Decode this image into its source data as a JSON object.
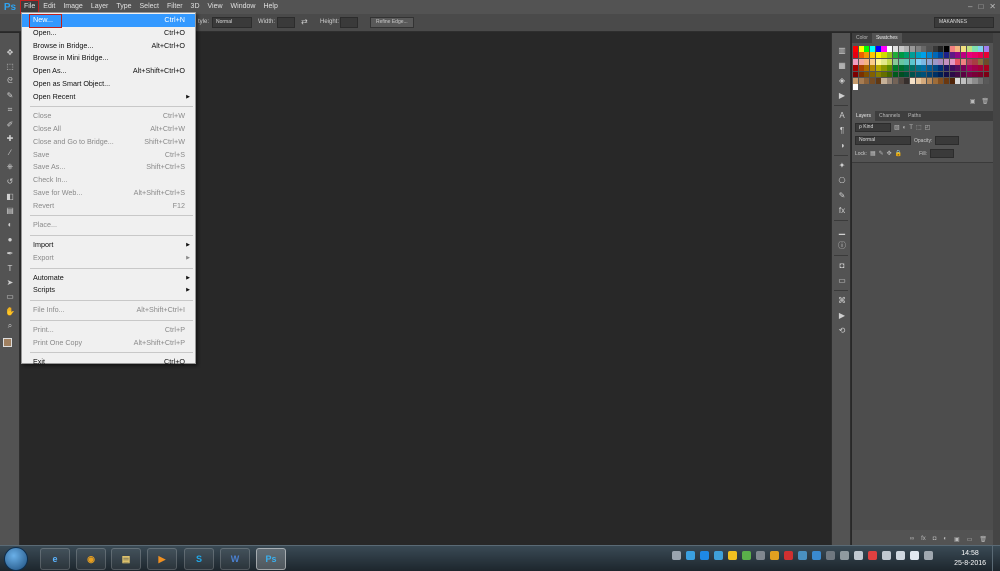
{
  "app": {
    "logo": "Ps"
  },
  "menubar": {
    "items": [
      "File",
      "Edit",
      "Image",
      "Layer",
      "Type",
      "Select",
      "Filter",
      "3D",
      "View",
      "Window",
      "Help"
    ],
    "window_buttons": [
      "–",
      "□",
      "✕"
    ]
  },
  "options_bar": {
    "style_label": "tyle:",
    "style_value": "Normal",
    "width_label": "Width:",
    "height_label": "Height:",
    "refine_edge": "Refine Edge...",
    "workspace": "MAKANNES"
  },
  "file_menu": {
    "items": [
      {
        "label": "New...",
        "shortcut": "Ctrl+N",
        "highlight": true
      },
      {
        "label": "Open...",
        "shortcut": "Ctrl+O"
      },
      {
        "label": "Browse in Bridge...",
        "shortcut": "Alt+Ctrl+O"
      },
      {
        "label": "Browse in Mini Bridge...",
        "shortcut": ""
      },
      {
        "label": "Open As...",
        "shortcut": "Alt+Shift+Ctrl+O"
      },
      {
        "label": "Open as Smart Object...",
        "shortcut": ""
      },
      {
        "label": "Open Recent",
        "shortcut": "",
        "submenu": true
      },
      {
        "sep": true
      },
      {
        "label": "Close",
        "shortcut": "Ctrl+W",
        "disabled": true
      },
      {
        "label": "Close All",
        "shortcut": "Alt+Ctrl+W",
        "disabled": true
      },
      {
        "label": "Close and Go to Bridge...",
        "shortcut": "Shift+Ctrl+W",
        "disabled": true
      },
      {
        "label": "Save",
        "shortcut": "Ctrl+S",
        "disabled": true
      },
      {
        "label": "Save As...",
        "shortcut": "Shift+Ctrl+S",
        "disabled": true
      },
      {
        "label": "Check In...",
        "shortcut": "",
        "disabled": true
      },
      {
        "label": "Save for Web...",
        "shortcut": "Alt+Shift+Ctrl+S",
        "disabled": true
      },
      {
        "label": "Revert",
        "shortcut": "F12",
        "disabled": true
      },
      {
        "sep": true
      },
      {
        "label": "Place...",
        "shortcut": "",
        "disabled": true
      },
      {
        "sep": true
      },
      {
        "label": "Import",
        "shortcut": "",
        "submenu": true
      },
      {
        "label": "Export",
        "shortcut": "",
        "submenu": true,
        "disabled": true
      },
      {
        "sep": true
      },
      {
        "label": "Automate",
        "shortcut": "",
        "submenu": true
      },
      {
        "label": "Scripts",
        "shortcut": "",
        "submenu": true
      },
      {
        "sep": true
      },
      {
        "label": "File Info...",
        "shortcut": "Alt+Shift+Ctrl+I",
        "disabled": true
      },
      {
        "sep": true
      },
      {
        "label": "Print...",
        "shortcut": "Ctrl+P",
        "disabled": true
      },
      {
        "label": "Print One Copy",
        "shortcut": "Alt+Shift+Ctrl+P",
        "disabled": true
      },
      {
        "sep": true
      },
      {
        "label": "Exit",
        "shortcut": "Ctrl+Q"
      }
    ]
  },
  "tools": [
    "move-tool-icon",
    "marquee-tool-icon",
    "lasso-tool-icon",
    "quick-select-tool-icon",
    "crop-tool-icon",
    "eyedropper-tool-icon",
    "healing-brush-tool-icon",
    "brush-tool-icon",
    "clone-stamp-tool-icon",
    "history-brush-tool-icon",
    "eraser-tool-icon",
    "gradient-tool-icon",
    "blur-tool-icon",
    "dodge-tool-icon",
    "pen-tool-icon",
    "type-tool-icon",
    "path-select-tool-icon",
    "shape-tool-icon",
    "hand-tool-icon",
    "zoom-tool-icon"
  ],
  "tool_glyphs": [
    "✥",
    "⬚",
    "ᘓ",
    "✎",
    "⌗",
    "✐",
    "✚",
    "∕",
    "⎈",
    "↺",
    "◧",
    "▤",
    "◐",
    "●",
    "✒",
    "T",
    "➤",
    "▭",
    "✋",
    "⌕"
  ],
  "colors": {
    "foreground": "#a08060",
    "background": "#ffffff",
    "accent": "#3399ff"
  },
  "side_icons": [
    "histogram-icon",
    "navigator-icon",
    "info-icon",
    "actions-icon",
    "character-icon",
    "paragraph-icon",
    "adjustments-icon",
    "brushes-icon",
    "clone-source-icon",
    "notes-icon",
    "styles-icon",
    "levels-icon",
    "properties-icon",
    "masks-icon",
    "timeline-icon",
    "history-icon",
    "play-icon",
    "tool-presets-icon"
  ],
  "side_glyphs": [
    "▥",
    "▦",
    "◈",
    "▶",
    "A",
    "¶",
    "◑",
    "✦",
    "⎔",
    "✎",
    "fx",
    "▁",
    "ⓘ",
    "◘",
    "▭",
    "⌘",
    "▶",
    "⟲"
  ],
  "panels": {
    "color_tabs": [
      "Color",
      "Swatches"
    ],
    "swatch_footer_icons": [
      "▣",
      "🗑"
    ],
    "layers_tabs": [
      "Layers",
      "Channels",
      "Paths"
    ],
    "kind_label": "ρ Kind",
    "blend_mode": "Normal",
    "opacity_label": "Opacity:",
    "lock_label": "Lock:",
    "fill_label": "Fill:",
    "layer_filter_glyphs": [
      "▧",
      "◐",
      "T",
      "⬚",
      "◰"
    ],
    "lock_glyphs": [
      "▦",
      "✎",
      "✥",
      "🔒"
    ],
    "footer_glyphs": [
      "∞",
      "fx",
      "◘",
      "◐",
      "▣",
      "▭",
      "🗑"
    ]
  },
  "swatches": [
    "#ff0000",
    "#ffff00",
    "#00ff00",
    "#00ffff",
    "#0000ff",
    "#ff00ff",
    "#ffffff",
    "#e0e0e0",
    "#c8c8c8",
    "#b0b0b0",
    "#989898",
    "#808080",
    "#686868",
    "#505050",
    "#383838",
    "#202020",
    "#000000",
    "#f28080",
    "#f2b580",
    "#f2e080",
    "#c0e080",
    "#80e0b0",
    "#80d0f0",
    "#a080f0",
    "#e60012",
    "#eb6100",
    "#f39800",
    "#fcc800",
    "#fff100",
    "#cfdb00",
    "#8fc31f",
    "#22ac38",
    "#009944",
    "#009b6b",
    "#009e96",
    "#00a0c1",
    "#00a0e9",
    "#0086d1",
    "#0068b7",
    "#00479d",
    "#1d2088",
    "#601986",
    "#920783",
    "#be0081",
    "#e4007f",
    "#e5006a",
    "#e5004f",
    "#e60033",
    "#f19ec2",
    "#f3a7a0",
    "#f6b37f",
    "#facd89",
    "#fff799",
    "#e3e98a",
    "#c3d94e",
    "#89c997",
    "#67c6a1",
    "#5ec4b6",
    "#5cc6d0",
    "#7ecef4",
    "#7ab8e4",
    "#8fa5d5",
    "#9b98c8",
    "#aa89bd",
    "#c490bf",
    "#e596c4",
    "#e95464",
    "#f08080",
    "#b33e5c",
    "#a83c43",
    "#8a6d3b",
    "#6b4d2b",
    "#a40000",
    "#a84200",
    "#ac6a00",
    "#b28500",
    "#b7aa00",
    "#8a9700",
    "#5b8a00",
    "#007a27",
    "#006e2e",
    "#006e4c",
    "#007167",
    "#00718b",
    "#006ea5",
    "#005a94",
    "#004985",
    "#002e73",
    "#1a1561",
    "#3f0e5e",
    "#5b0c5e",
    "#7b0059",
    "#a40062",
    "#a2004b",
    "#a40037",
    "#a6001d",
    "#7d0000",
    "#7b3100",
    "#7d4e00",
    "#826100",
    "#837c00",
    "#666e00",
    "#426500",
    "#005a1d",
    "#004f22",
    "#004f37",
    "#00524c",
    "#005167",
    "#005079",
    "#004070",
    "#003165",
    "#001f55",
    "#120e49",
    "#2c0a47",
    "#420945",
    "#5b0042",
    "#7b0048",
    "#790037",
    "#7b0028",
    "#7c0014",
    "#c69c6d",
    "#a67c52",
    "#8c6239",
    "#754c24",
    "#603813",
    "#c7b299",
    "#998675",
    "#736357",
    "#534741",
    "#362f2d",
    "#f5e1c8",
    "#e8c8a0",
    "#d4aa7d",
    "#ba8b5a",
    "#9e6d3a",
    "#845020",
    "#6a3810",
    "#502408",
    "#d9d9d9",
    "#bfbfbf",
    "#a6a6a6",
    "#8c8c8c",
    "#737373",
    "#595959",
    "#ffffff"
  ],
  "taskbar": {
    "apps": [
      "e",
      "◉",
      "▤",
      "▶",
      "S",
      "W",
      "Ps"
    ],
    "tray_colors": [
      "#9aa5b0",
      "#3aa0e0",
      "#1e88e5",
      "#3fa0d8",
      "#f0c020",
      "#5ab04a",
      "#808890",
      "#e0a020",
      "#d03030",
      "#4a90c0",
      "#3a8ad0",
      "#707880",
      "#909aa0",
      "#c0c8d0",
      "#e04040",
      "#c0c8d0",
      "#d0d8e0",
      "#e0e8f0",
      "#a0a8b0"
    ],
    "time": "14:58",
    "date": "25-8-2016"
  }
}
